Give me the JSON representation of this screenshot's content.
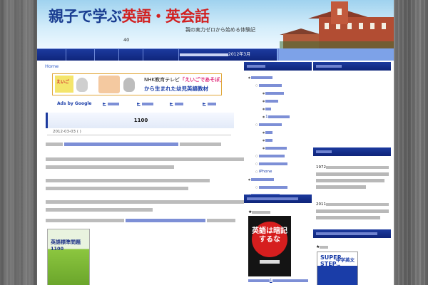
{
  "header": {
    "title_part1": "親子で学ぶ",
    "title_part2": "英語・英会話",
    "subtitle": "親の実力ゼロから始める体験記",
    "counter": "40"
  },
  "nav": {
    "items": [
      {
        "label": ""
      },
      {
        "label": ""
      },
      {
        "label": ""
      },
      {
        "label": ""
      },
      {
        "label": ""
      },
      {
        "label": "2012年3月"
      }
    ]
  },
  "main": {
    "breadcrumb": "Home",
    "banner": {
      "logo_text": "えいご",
      "line1_prefix": "NHK教育テレビ",
      "line1_highlight": "「えいごであそぼ」",
      "line2": "から生まれた幼児英語教材"
    },
    "ads_label": "Ads by Google",
    "ad_links": [
      "►",
      "►",
      "►",
      "►"
    ],
    "post": {
      "title": "1100",
      "meta": "2012-03-03 ( )"
    },
    "book": {
      "line1": "",
      "line2": "英語標準問題",
      "line3": "1100"
    }
  },
  "middle_sidebar": {
    "head1": "",
    "items": [
      {
        "label": "",
        "level": 0
      },
      {
        "label": "",
        "level": 1
      },
      {
        "label": "",
        "level": 2
      },
      {
        "label": "",
        "level": 2
      },
      {
        "label": "",
        "level": 2
      },
      {
        "label": "1",
        "level": 2
      },
      {
        "label": "",
        "level": 1
      },
      {
        "label": "",
        "level": 2
      },
      {
        "label": "",
        "level": 2
      },
      {
        "label": "",
        "level": 2
      },
      {
        "label": "",
        "level": 1
      },
      {
        "label": "",
        "level": 1
      },
      {
        "label": "iPhone",
        "level": 1
      },
      {
        "label": "",
        "level": 0
      },
      {
        "label": "",
        "level": 1
      },
      {
        "label": "",
        "level": 0
      }
    ],
    "head2": "",
    "star_title": "★",
    "book_text": "英語は暗記するな",
    "book_link": "1"
  },
  "right_sidebar": {
    "head1": "",
    "head2": "",
    "text_1972": "1972",
    "text_2011": "2011",
    "head3": "",
    "star_title": "★",
    "book_text1": "SUPER STEP",
    "book_text2": "中学英文法"
  }
}
